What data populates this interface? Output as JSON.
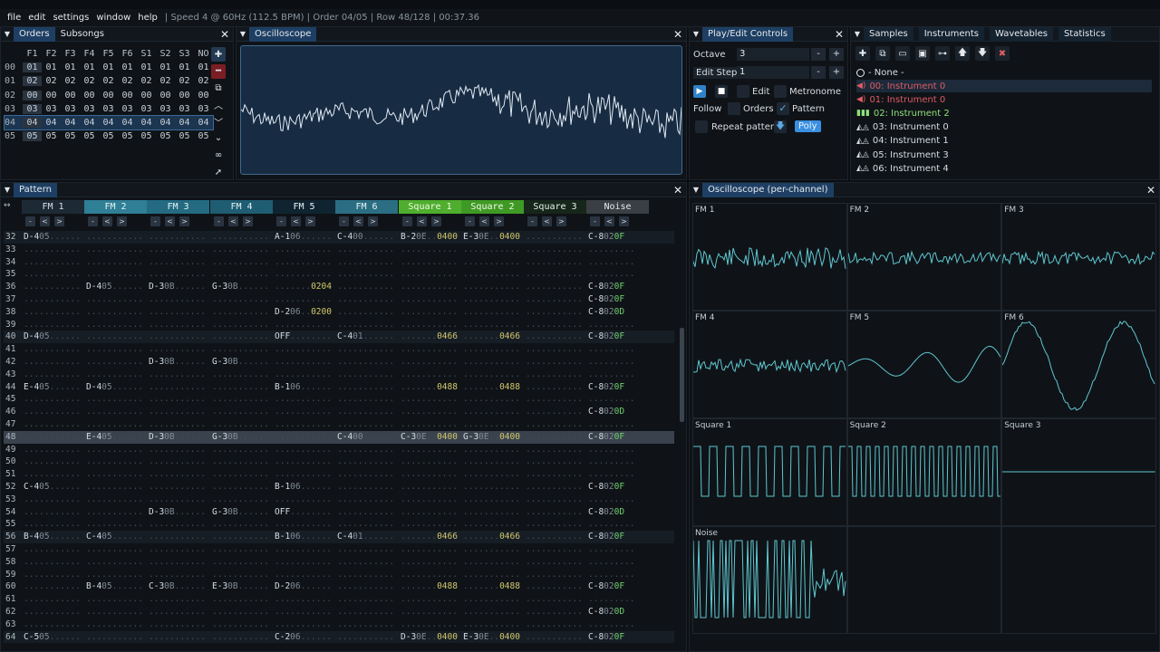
{
  "menubar": {
    "items": [
      "file",
      "edit",
      "settings",
      "window",
      "help"
    ],
    "status": "| Speed 4 @ 60Hz (112.5 BPM) | Order 04/05 | Row 48/128 | 00:37.36"
  },
  "orders": {
    "tabs": [
      "Orders",
      "Subsongs"
    ],
    "columns": [
      "F1",
      "F2",
      "F3",
      "F4",
      "F5",
      "F6",
      "S1",
      "S2",
      "S3",
      "NO"
    ],
    "rows": [
      {
        "num": "00",
        "vals": [
          "01",
          "01",
          "01",
          "01",
          "01",
          "01",
          "01",
          "01",
          "01",
          "01"
        ]
      },
      {
        "num": "01",
        "vals": [
          "02",
          "02",
          "02",
          "02",
          "02",
          "02",
          "02",
          "02",
          "02",
          "02"
        ]
      },
      {
        "num": "02",
        "vals": [
          "00",
          "00",
          "00",
          "00",
          "00",
          "00",
          "00",
          "00",
          "00",
          "00"
        ]
      },
      {
        "num": "03",
        "vals": [
          "03",
          "03",
          "03",
          "03",
          "03",
          "03",
          "03",
          "03",
          "03",
          "03"
        ]
      },
      {
        "num": "04",
        "vals": [
          "04",
          "04",
          "04",
          "04",
          "04",
          "04",
          "04",
          "04",
          "04",
          "04"
        ]
      },
      {
        "num": "05",
        "vals": [
          "05",
          "05",
          "05",
          "05",
          "05",
          "05",
          "05",
          "05",
          "05",
          "05"
        ]
      }
    ],
    "selected_row": 4
  },
  "oscilloscope": {
    "title": "Oscilloscope"
  },
  "playedit": {
    "title": "Play/Edit Controls",
    "octave_label": "Octave",
    "octave_value": "3",
    "editstep_label": "Edit Step",
    "editstep_value": "1",
    "edit_label": "Edit",
    "metronome_label": "Metronome",
    "follow_label": "Follow",
    "orders_label": "Orders",
    "pattern_label": "Pattern",
    "repeat_label": "Repeat pattern",
    "poly_label": "Poly",
    "minus": "-",
    "plus": "+"
  },
  "samples": {
    "tabs": [
      "Samples",
      "Instruments",
      "Wavetables",
      "Statistics"
    ],
    "none_label": "- None -",
    "instruments": [
      {
        "label": "00: Instrument 0",
        "color": "#e05a63",
        "icon": "speaker-icon"
      },
      {
        "label": "01: Instrument 0",
        "color": "#e05a63",
        "icon": "speaker-icon"
      },
      {
        "label": "02: Instrument 2",
        "color": "#8fe07a",
        "icon": "bars-icon"
      },
      {
        "label": "03: Instrument 0",
        "color": "#d6dde4",
        "icon": "wave-icon"
      },
      {
        "label": "04: Instrument 1",
        "color": "#d6dde4",
        "icon": "wave-icon"
      },
      {
        "label": "05: Instrument 3",
        "color": "#d6dde4",
        "icon": "wave-icon"
      },
      {
        "label": "06: Instrument 4",
        "color": "#d6dde4",
        "icon": "wave-icon"
      }
    ]
  },
  "pattern": {
    "title": "Pattern",
    "channels": [
      {
        "name": "FM 1",
        "bg": "#1d2a36",
        "fg": "#d9dee4"
      },
      {
        "name": "FM 2",
        "bg": "#2f7f96",
        "fg": "#e6f3f7"
      },
      {
        "name": "FM 3",
        "bg": "#246b82",
        "fg": "#e6f3f7"
      },
      {
        "name": "FM 4",
        "bg": "#1f5d73",
        "fg": "#e6f3f7"
      },
      {
        "name": "FM 5",
        "bg": "#0f2430",
        "fg": "#e6f3f7"
      },
      {
        "name": "FM 6",
        "bg": "#2b6e83",
        "fg": "#e6f3f7"
      },
      {
        "name": "Square 1",
        "bg": "#4fae2d",
        "fg": "#f2fbe9"
      },
      {
        "name": "Square 2",
        "bg": "#3f9a25",
        "fg": "#f2fbe9"
      },
      {
        "name": "Square 3",
        "bg": "#17261b",
        "fg": "#e6f3e6"
      },
      {
        "name": "Noise",
        "bg": "#3a3f44",
        "fg": "#e6e9ed"
      }
    ],
    "ctl": [
      "-",
      "<",
      ">"
    ],
    "rows": [
      {
        "n": "32",
        "c": [
          [
            "D-4",
            "05",
            ""
          ],
          [
            "",
            "",
            ""
          ],
          [
            "",
            "",
            ""
          ],
          [
            "",
            "",
            ""
          ],
          [
            "A-1",
            "06",
            ""
          ],
          [
            "C-4",
            "00",
            ""
          ],
          [
            "B-2",
            "0E",
            "0400"
          ],
          [
            "E-3",
            "0E",
            "0400"
          ],
          [
            "",
            "",
            ""
          ],
          [
            "C-8",
            "02",
            "0F"
          ]
        ]
      },
      {
        "n": "33",
        "c": []
      },
      {
        "n": "34",
        "c": []
      },
      {
        "n": "35",
        "c": []
      },
      {
        "n": "36",
        "c": [
          [
            "",
            "",
            ""
          ],
          [
            "D-4",
            "05",
            ""
          ],
          [
            "D-3",
            "0B",
            ""
          ],
          [
            "G-3",
            "0B",
            ""
          ],
          [
            "",
            "",
            "0204"
          ],
          [
            "",
            "",
            ""
          ],
          [
            "",
            "",
            ""
          ],
          [
            "",
            "",
            ""
          ],
          [
            "",
            "",
            ""
          ],
          [
            "C-8",
            "02",
            "0F"
          ]
        ]
      },
      {
        "n": "37",
        "c": [
          [
            "",
            "",
            ""
          ],
          [
            "",
            "",
            ""
          ],
          [
            "",
            "",
            ""
          ],
          [
            "",
            "",
            ""
          ],
          [
            "",
            "",
            ""
          ],
          [
            "",
            "",
            ""
          ],
          [
            "",
            "",
            ""
          ],
          [
            "",
            "",
            ""
          ],
          [
            "",
            "",
            ""
          ],
          [
            "C-8",
            "02",
            "0F"
          ]
        ]
      },
      {
        "n": "38",
        "c": [
          [
            "",
            "",
            ""
          ],
          [
            "",
            "",
            ""
          ],
          [
            "",
            "",
            ""
          ],
          [
            "",
            "",
            ""
          ],
          [
            "D-2",
            "06",
            "0200"
          ],
          [
            "",
            "",
            ""
          ],
          [
            "",
            "",
            ""
          ],
          [
            "",
            "",
            ""
          ],
          [
            "",
            "",
            ""
          ],
          [
            "C-8",
            "02",
            "0D"
          ]
        ]
      },
      {
        "n": "39",
        "c": []
      },
      {
        "n": "40",
        "c": [
          [
            "D-4",
            "05",
            ""
          ],
          [
            "",
            "",
            ""
          ],
          [
            "",
            "",
            ""
          ],
          [
            "",
            "",
            ""
          ],
          [
            "OFF",
            "",
            ""
          ],
          [
            "C-4",
            "01",
            ""
          ],
          [
            "",
            "",
            "0466"
          ],
          [
            "",
            "",
            "0466"
          ],
          [
            "",
            "",
            ""
          ],
          [
            "C-8",
            "02",
            "0F"
          ]
        ]
      },
      {
        "n": "41",
        "c": []
      },
      {
        "n": "42",
        "c": [
          [
            "",
            "",
            ""
          ],
          [
            "",
            "",
            ""
          ],
          [
            "D-3",
            "0B",
            ""
          ],
          [
            "G-3",
            "0B",
            ""
          ],
          [
            "",
            "",
            ""
          ],
          [
            "",
            "",
            ""
          ],
          [
            "",
            "",
            ""
          ],
          [
            "",
            "",
            ""
          ],
          [
            "",
            "",
            ""
          ],
          [
            "",
            "",
            ""
          ]
        ]
      },
      {
        "n": "43",
        "c": []
      },
      {
        "n": "44",
        "c": [
          [
            "E-4",
            "05",
            ""
          ],
          [
            "D-4",
            "05",
            ""
          ],
          [
            "",
            "",
            ""
          ],
          [
            "",
            "",
            ""
          ],
          [
            "B-1",
            "06",
            ""
          ],
          [
            "",
            "",
            ""
          ],
          [
            "",
            "",
            "0488"
          ],
          [
            "",
            "",
            "0488"
          ],
          [
            "",
            "",
            ""
          ],
          [
            "C-8",
            "02",
            "0F"
          ]
        ]
      },
      {
        "n": "45",
        "c": []
      },
      {
        "n": "46",
        "c": [
          [
            "",
            "",
            ""
          ],
          [
            "",
            "",
            ""
          ],
          [
            "",
            "",
            ""
          ],
          [
            "",
            "",
            ""
          ],
          [
            "",
            "",
            ""
          ],
          [
            "",
            "",
            ""
          ],
          [
            "",
            "",
            ""
          ],
          [
            "",
            "",
            ""
          ],
          [
            "",
            "",
            ""
          ],
          [
            "C-8",
            "02",
            "0D"
          ]
        ]
      },
      {
        "n": "47",
        "c": []
      },
      {
        "n": "48",
        "c": [
          [
            "",
            "",
            ""
          ],
          [
            "E-4",
            "05",
            ""
          ],
          [
            "D-3",
            "0B",
            ""
          ],
          [
            "G-3",
            "0B",
            ""
          ],
          [
            "",
            "",
            ""
          ],
          [
            "C-4",
            "00",
            ""
          ],
          [
            "C-3",
            "0E",
            "0400"
          ],
          [
            "G-3",
            "0E",
            "0400"
          ],
          [
            "",
            "",
            ""
          ],
          [
            "C-8",
            "02",
            "0F"
          ]
        ]
      },
      {
        "n": "49",
        "c": []
      },
      {
        "n": "50",
        "c": []
      },
      {
        "n": "51",
        "c": []
      },
      {
        "n": "52",
        "c": [
          [
            "C-4",
            "05",
            ""
          ],
          [
            "",
            "",
            ""
          ],
          [
            "",
            "",
            ""
          ],
          [
            "",
            "",
            ""
          ],
          [
            "B-1",
            "06",
            ""
          ],
          [
            "",
            "",
            ""
          ],
          [
            "",
            "",
            ""
          ],
          [
            "",
            "",
            ""
          ],
          [
            "",
            "",
            ""
          ],
          [
            "C-8",
            "02",
            "0F"
          ]
        ]
      },
      {
        "n": "53",
        "c": []
      },
      {
        "n": "54",
        "c": [
          [
            "",
            "",
            ""
          ],
          [
            "",
            "",
            ""
          ],
          [
            "D-3",
            "0B",
            ""
          ],
          [
            "G-3",
            "0B",
            ""
          ],
          [
            "OFF",
            "",
            ""
          ],
          [
            "",
            "",
            ""
          ],
          [
            "",
            "",
            ""
          ],
          [
            "",
            "",
            ""
          ],
          [
            "",
            "",
            ""
          ],
          [
            "C-8",
            "02",
            "0D"
          ]
        ]
      },
      {
        "n": "55",
        "c": []
      },
      {
        "n": "56",
        "c": [
          [
            "B-4",
            "05",
            ""
          ],
          [
            "C-4",
            "05",
            ""
          ],
          [
            "",
            "",
            ""
          ],
          [
            "",
            "",
            ""
          ],
          [
            "B-1",
            "06",
            ""
          ],
          [
            "C-4",
            "01",
            ""
          ],
          [
            "",
            "",
            "0466"
          ],
          [
            "",
            "",
            "0466"
          ],
          [
            "",
            "",
            ""
          ],
          [
            "C-8",
            "02",
            "0F"
          ]
        ]
      },
      {
        "n": "57",
        "c": []
      },
      {
        "n": "58",
        "c": []
      },
      {
        "n": "59",
        "c": []
      },
      {
        "n": "60",
        "c": [
          [
            "",
            "",
            ""
          ],
          [
            "B-4",
            "05",
            ""
          ],
          [
            "C-3",
            "0B",
            ""
          ],
          [
            "E-3",
            "0B",
            ""
          ],
          [
            "D-2",
            "06",
            ""
          ],
          [
            "",
            "",
            ""
          ],
          [
            "",
            "",
            "0488"
          ],
          [
            "",
            "",
            "0488"
          ],
          [
            "",
            "",
            ""
          ],
          [
            "C-8",
            "02",
            "0F"
          ]
        ]
      },
      {
        "n": "61",
        "c": []
      },
      {
        "n": "62",
        "c": [
          [
            "",
            "",
            ""
          ],
          [
            "",
            "",
            ""
          ],
          [
            "",
            "",
            ""
          ],
          [
            "",
            "",
            ""
          ],
          [
            "",
            "",
            ""
          ],
          [
            "",
            "",
            ""
          ],
          [
            "",
            "",
            ""
          ],
          [
            "",
            "",
            ""
          ],
          [
            "",
            "",
            ""
          ],
          [
            "C-8",
            "02",
            "0D"
          ]
        ]
      },
      {
        "n": "63",
        "c": []
      },
      {
        "n": "64",
        "c": [
          [
            "C-5",
            "05",
            ""
          ],
          [
            "",
            "",
            ""
          ],
          [
            "",
            "",
            ""
          ],
          [
            "",
            "",
            ""
          ],
          [
            "C-2",
            "06",
            ""
          ],
          [
            "",
            "",
            ""
          ],
          [
            "D-3",
            "0E",
            "0400"
          ],
          [
            "E-3",
            "0E",
            "0400"
          ],
          [
            "",
            "",
            ""
          ],
          [
            "C-8",
            "02",
            "0F"
          ]
        ]
      }
    ],
    "current_row": "48"
  },
  "perchannel": {
    "title": "Oscilloscope (per-channel)",
    "cells": [
      {
        "label": "FM 1",
        "kind": "noise"
      },
      {
        "label": "FM 2",
        "kind": "noise-small"
      },
      {
        "label": "FM 3",
        "kind": "noise-small"
      },
      {
        "label": "FM 4",
        "kind": "noise-small"
      },
      {
        "label": "FM 5",
        "kind": "sine-small"
      },
      {
        "label": "FM 6",
        "kind": "sine-big"
      },
      {
        "label": "Square 1",
        "kind": "square"
      },
      {
        "label": "Square 2",
        "kind": "square-fast"
      },
      {
        "label": "Square 3",
        "kind": "flat"
      },
      {
        "label": "Noise",
        "kind": "noise-square"
      },
      {
        "label": "",
        "kind": "empty"
      },
      {
        "label": "",
        "kind": "empty"
      }
    ],
    "wave_color": "#5fc7d1"
  }
}
